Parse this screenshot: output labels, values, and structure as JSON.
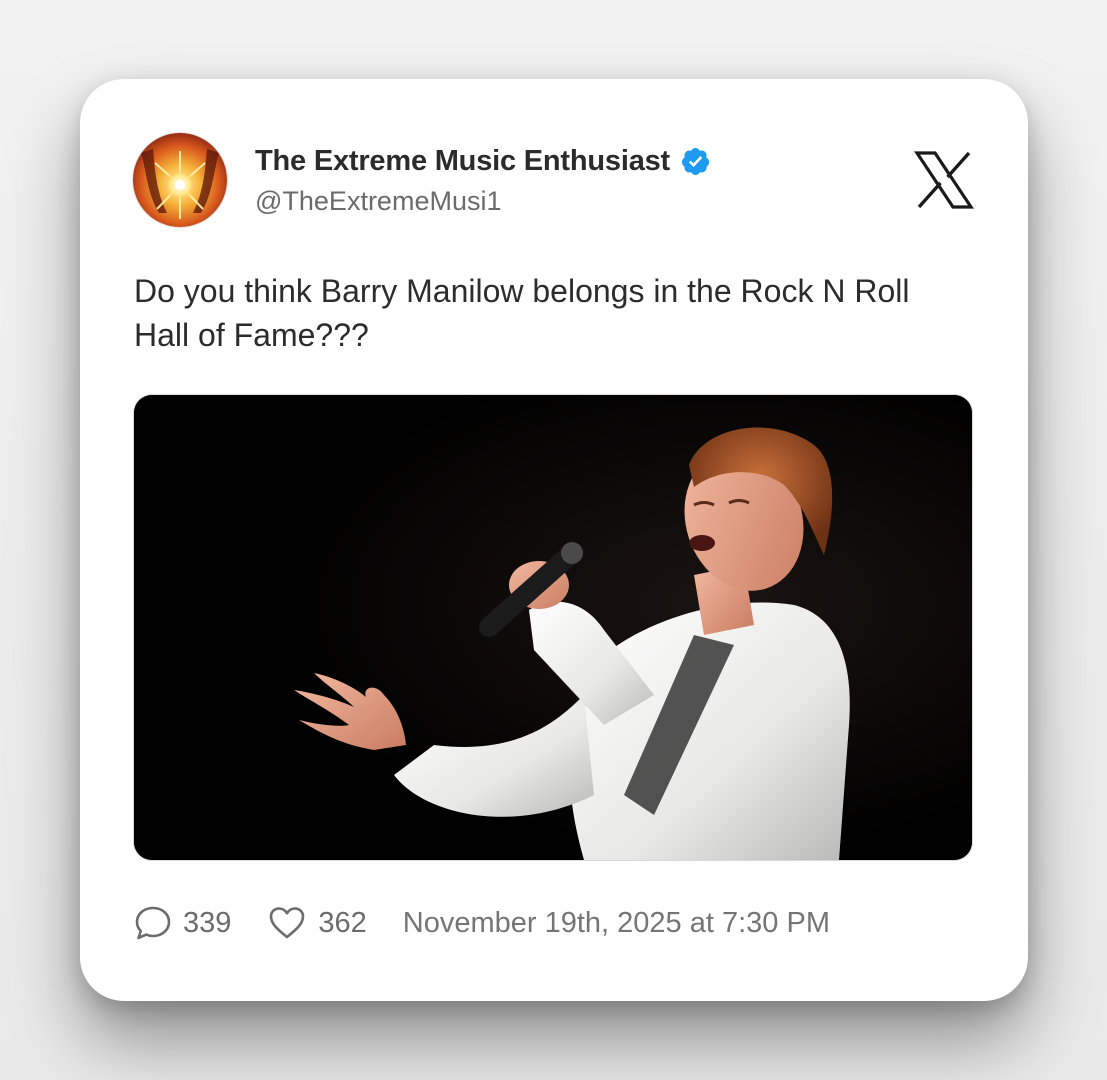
{
  "tweet": {
    "author": {
      "display_name": "The Extreme Music Enthusiast",
      "handle": "@TheExtremeMusi1",
      "verified": true,
      "avatar_icon": "sunburst-avatar"
    },
    "platform_icon": "x-logo-icon",
    "text": "Do you think Barry Manilow belongs in the Rock N Roll Hall of Fame???",
    "media": {
      "type": "photo",
      "icon": "performer-photo"
    },
    "stats": {
      "replies": "339",
      "likes": "362",
      "timestamp": "November 19th, 2025 at 7:30 PM"
    }
  },
  "colors": {
    "verified_blue": "#1d9bf0",
    "text_primary": "#2b2b2b",
    "text_secondary": "#6b6b6b",
    "card_background": "#ffffff"
  }
}
